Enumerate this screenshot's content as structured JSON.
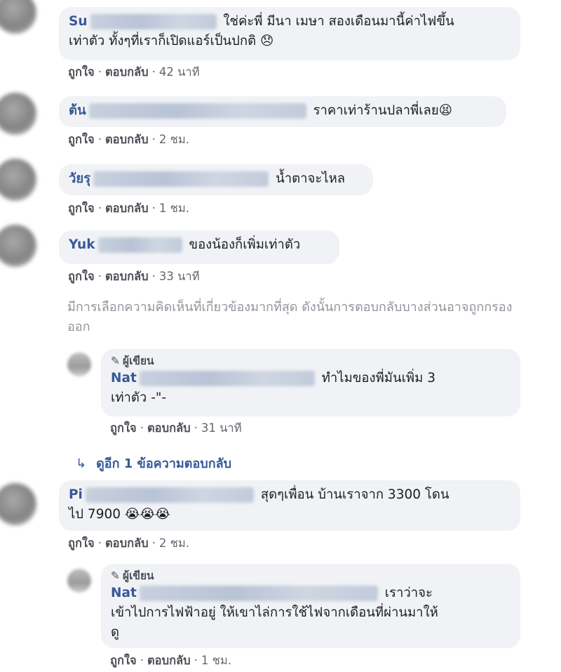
{
  "actions": {
    "like": "ถูกใจ",
    "reply": "ตอบกลับ"
  },
  "comments": [
    {
      "author": "Su",
      "text_1": "ใช่ค่ะพี่ มีนา เมษา สองเดือนมานี้ค่าไฟขึ้น",
      "text_2": "เท่าตัว ทั้งๆที่เราก็เปิดแอร์เป็นปกติ",
      "emoji": "😞",
      "time": "42 นาที"
    },
    {
      "author": "ต้น",
      "text": "ราคาเท่าร้านปลาพี่เลย",
      "emoji": "😫",
      "time": "2 ชม."
    },
    {
      "author": "วัยรุ",
      "text": "น้ำตาจะไหล",
      "time": "1 ชม."
    },
    {
      "author": "Yuk",
      "text": "ของน้องก็เพิ่มเท่าตัว",
      "time": "33 นาที"
    }
  ],
  "notice": "มีการเลือกความคิดเห็นที่เกี่ยวข้องมากที่สุด ดังนั้นการตอบกลับบางส่วนอาจถูกกรองออก",
  "reply_1": {
    "badge": "ผู้เขียน",
    "author": "Nat",
    "text_1": "ทำไมของพี่มันเพิ่ม 3",
    "text_2": "เท่าตัว -\"-",
    "time": "31 นาที"
  },
  "view_more": "ดูอีก 1 ข้อความตอบกลับ",
  "comment_5": {
    "author": "Pi",
    "text_1": "สุดๆเพื่อน บ้านเราจาก 3300 โดน",
    "text_2": "ไป 7900",
    "emoji": "😭😭😭",
    "time": "2 ชม."
  },
  "reply_2": {
    "badge": "ผู้เขียน",
    "author": "Nat",
    "text_1": "เราว่าจะ",
    "text_2": "เข้าไปการไฟฟ้าอยู่ ให้เขาไล่การใช้ไฟจากเดือนที่ผ่านมาให้",
    "text_3": "ดู",
    "time": "1 ชม."
  },
  "colors": {
    "link": "#385898",
    "bubble": "#f0f2f5",
    "muted": "#90949c"
  }
}
